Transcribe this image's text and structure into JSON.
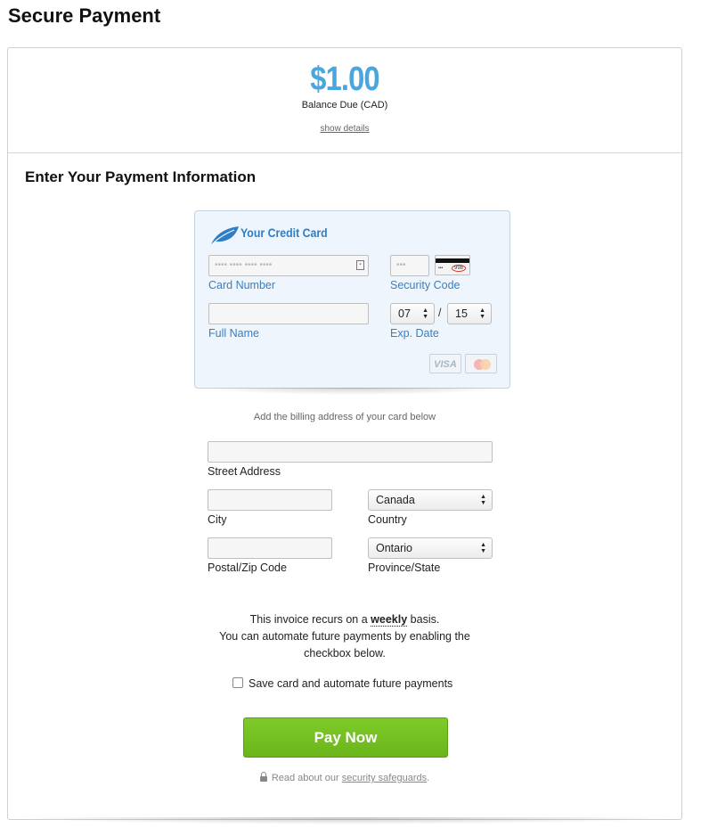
{
  "page": {
    "title": "Secure Payment"
  },
  "summary": {
    "amount": "$1.00",
    "balance_label": "Balance Due (CAD)",
    "show_details": "show details"
  },
  "form": {
    "title": "Enter Your Payment Information",
    "card": {
      "heading": "Your Credit Card",
      "card_number_placeholder": "•••• •••• •••• ••••",
      "card_number_label": "Card Number",
      "security_code_placeholder": "•••",
      "security_code_label": "Security Code",
      "cvv_sample": "998",
      "full_name_label": "Full Name",
      "exp_month": "07",
      "exp_separator": "/",
      "exp_year": "15",
      "exp_label": "Exp. Date",
      "visa": "VISA"
    },
    "billing_note": "Add the billing address of your card below",
    "street_label": "Street Address",
    "city_label": "City",
    "country_value": "Canada",
    "country_label": "Country",
    "postal_label": "Postal/Zip Code",
    "province_value": "Ontario",
    "province_label": "Province/State"
  },
  "recurring": {
    "line1_prefix": "This invoice recurs on a",
    "frequency": "weekly",
    "line1_suffix": "basis.",
    "line2": "You can automate future payments by enabling the",
    "line3": "checkbox below.",
    "checkbox_label": "Save card and automate future payments"
  },
  "actions": {
    "pay_now": "Pay Now"
  },
  "footer": {
    "security_prefix": "Read about our",
    "security_link": "security safeguards",
    "security_suffix": "."
  },
  "colors": {
    "amount": "#4aa6de",
    "accent_blue": "#3a7ec2",
    "pay_button": "#76c123"
  }
}
